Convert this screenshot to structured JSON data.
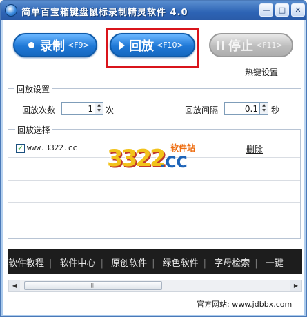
{
  "window": {
    "title": "简单百宝箱键盘鼠标录制精灵软件 4.0",
    "min_label": "—",
    "max_label": "□",
    "close_label": "✕"
  },
  "toolbar": {
    "record_label": "录制",
    "record_key": "<F9>",
    "play_label": "回放",
    "play_key": "<F10>",
    "stop_label": "停止",
    "stop_key": "<F11>",
    "hotkey_settings": "热键设置"
  },
  "playback_settings": {
    "legend": "回放设置",
    "count_label": "回放次数",
    "count_value": "1",
    "count_unit": "次",
    "interval_label": "回放间隔",
    "interval_value": "0.1",
    "interval_unit": "秒"
  },
  "playback_select": {
    "legend": "回放选择",
    "items": [
      {
        "name": "www.3322.cc",
        "checked": true,
        "action": "删除"
      }
    ]
  },
  "watermark": {
    "number": "3322",
    "domain": ".CC",
    "tag": "软件站"
  },
  "link_bar": {
    "items": [
      "软件教程",
      "软件中心",
      "原创软件",
      "绿色软件",
      "字母检索",
      "一键"
    ]
  },
  "scroll": {
    "thumb_label": "|||"
  },
  "footer": {
    "text": "官方网站: www.jdbbx.com"
  },
  "colors": {
    "titlebar": "#2d64b5",
    "button_blue": "#1f78d6",
    "button_disabled": "#bdbdbd",
    "highlight": "#d9141b",
    "link_bar_bg": "#1d1d1d"
  }
}
